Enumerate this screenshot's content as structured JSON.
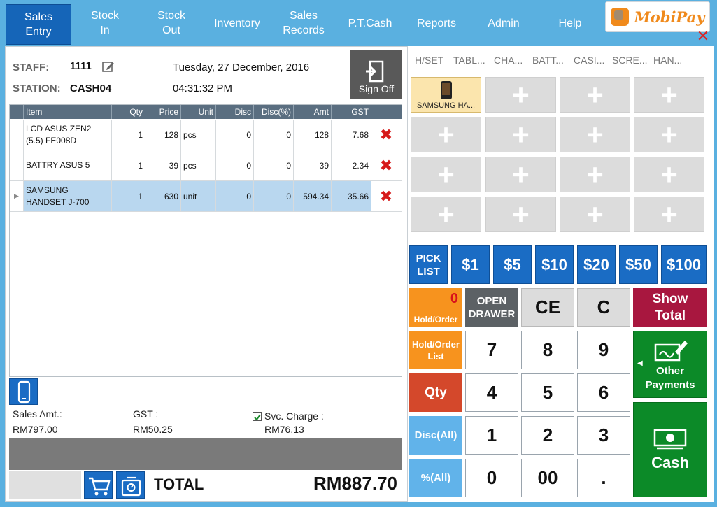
{
  "nav": {
    "items": [
      {
        "label": "Sales\nEntry",
        "active": true
      },
      {
        "label": "Stock\nIn"
      },
      {
        "label": "Stock\nOut"
      },
      {
        "label": "Inventory"
      },
      {
        "label": "Sales\nRecords"
      },
      {
        "label": "P.T.Cash"
      },
      {
        "label": "Reports"
      },
      {
        "label": "Admin"
      },
      {
        "label": "Help"
      }
    ],
    "logo_text": "MobiPay"
  },
  "header": {
    "staff_label": "STAFF:",
    "staff_value": "1111",
    "station_label": "STATION:",
    "station_value": "CASH04",
    "date": "Tuesday, 27 December, 2016",
    "time": "04:31:32 PM",
    "sign_off": "Sign Off"
  },
  "table": {
    "columns": [
      "Item",
      "Qty",
      "Price",
      "Unit",
      "Disc",
      "Disc(%)",
      "Amt",
      "GST"
    ],
    "rows": [
      {
        "item": "LCD ASUS ZEN2\n(5.5) FE008D",
        "qty": "1",
        "price": "128",
        "unit": "pcs",
        "disc": "0",
        "discp": "0",
        "amt": "128",
        "gst": "7.68"
      },
      {
        "item": "BATTRY ASUS 5",
        "qty": "1",
        "price": "39",
        "unit": "pcs",
        "disc": "0",
        "discp": "0",
        "amt": "39",
        "gst": "2.34"
      },
      {
        "item": "SAMSUNG\nHANDSET J-700",
        "qty": "1",
        "price": "630",
        "unit": "unit",
        "disc": "0",
        "discp": "0",
        "amt": "594.34",
        "gst": "35.66",
        "selected": true
      }
    ]
  },
  "summary": {
    "sales_amt_label": "Sales Amt.:",
    "sales_amt_value": "RM797.00",
    "gst_label": "GST :",
    "gst_value": "RM50.25",
    "svc_label": "Svc. Charge :",
    "svc_value": "RM76.13",
    "svc_checked": true
  },
  "total": {
    "label": "TOTAL",
    "value": "RM887.70"
  },
  "categories": [
    "H/SET",
    "TABL...",
    "CHA...",
    "BATT...",
    "CASI...",
    "SCRE...",
    "HAN..."
  ],
  "products": [
    {
      "label": "SAMSUNG HA..."
    }
  ],
  "quick_cash": {
    "pick_list": "PICK\nLIST",
    "amounts": [
      "$1",
      "$5",
      "$10",
      "$20",
      "$50",
      "$100"
    ]
  },
  "keypad": {
    "hold_count": "0",
    "hold_order": "Hold/Order",
    "open_drawer": "OPEN\nDRAWER",
    "ce": "CE",
    "c": "C",
    "show_total": "Show\nTotal",
    "hold_order_list": "Hold/Order\nList",
    "qty": "Qty",
    "disc_all": "Disc(All)",
    "pct_all": "%(All)",
    "digits": [
      "7",
      "8",
      "9",
      "4",
      "5",
      "6",
      "1",
      "2",
      "3",
      "0",
      "00",
      "."
    ],
    "other_payments": "Other\nPayments",
    "cash": "Cash"
  },
  "colors": {
    "nav_bg": "#5ab0e0",
    "accent_blue": "#1a6cc4",
    "orange": "#f7931e",
    "green": "#0c8a28",
    "red_btn": "#a8173f"
  }
}
